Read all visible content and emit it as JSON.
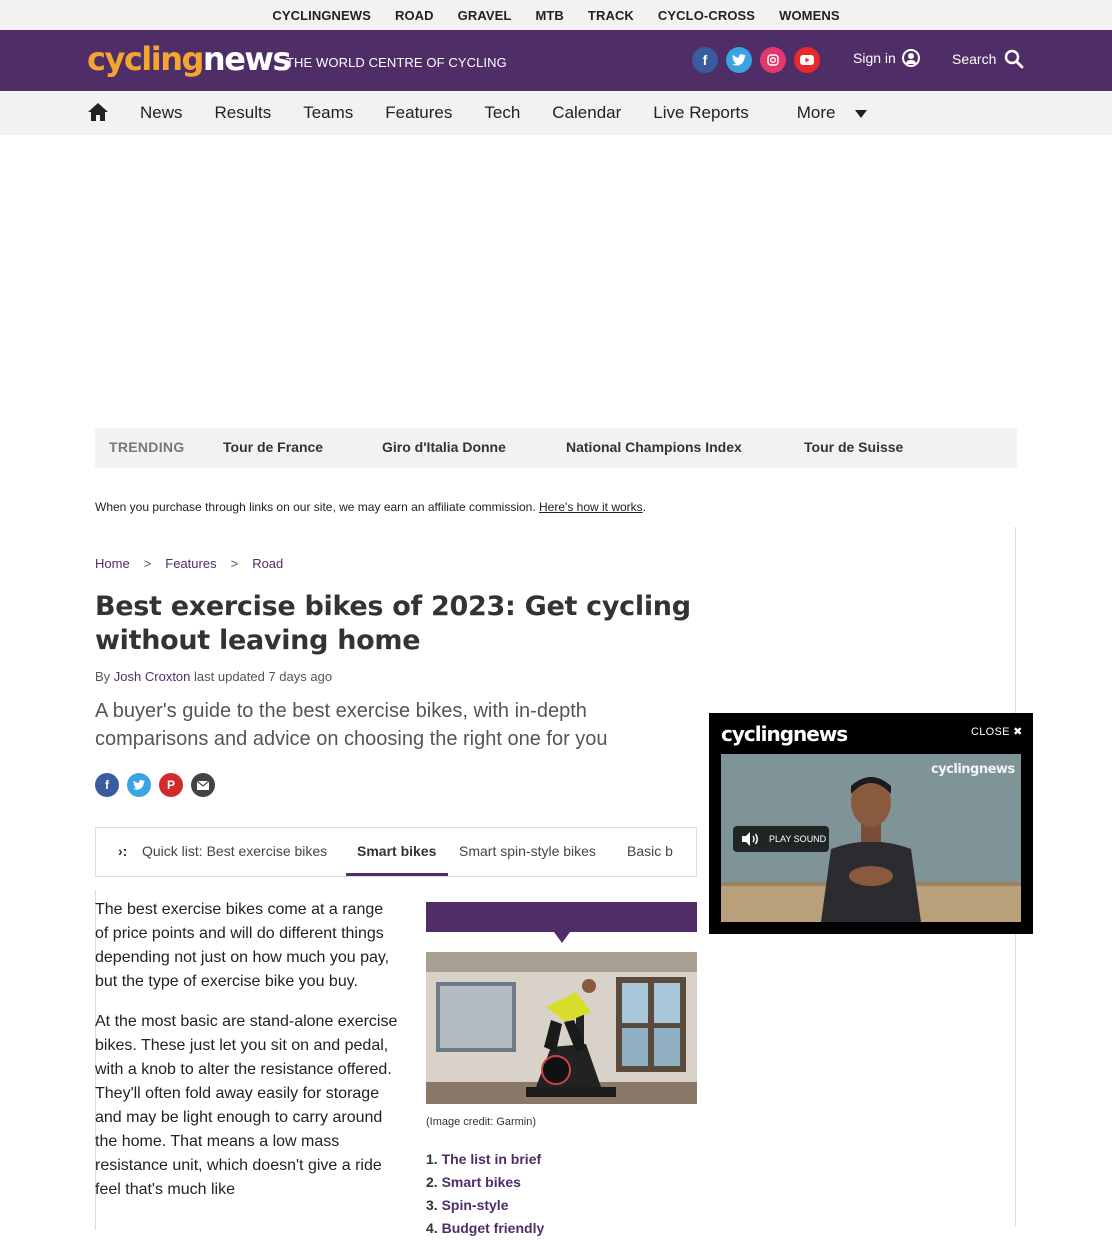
{
  "topbar": {
    "items": [
      "CYCLINGNEWS",
      "ROAD",
      "GRAVEL",
      "MTB",
      "TRACK",
      "CYCLO-CROSS",
      "WOMENS"
    ]
  },
  "header": {
    "logo_part1": "cycling",
    "logo_part2": "news",
    "tagline": "THE WORLD CENTRE OF CYCLING",
    "signin": "Sign in",
    "search": "Search",
    "brand_color": "#4f2e68"
  },
  "nav": {
    "items": [
      "News",
      "Results",
      "Teams",
      "Features",
      "Tech",
      "Calendar",
      "Live Reports"
    ],
    "more": "More"
  },
  "trending": {
    "label": "TRENDING",
    "items": [
      "Tour de France",
      "Giro d'Italia Donne",
      "National Champions Index",
      "Tour de Suisse"
    ]
  },
  "affiliate": {
    "text": "When you purchase through links on our site, we may earn an affiliate commission.",
    "link": "Here's how it works",
    "period": "."
  },
  "breadcrumb": {
    "items": [
      "Home",
      "Features",
      "Road"
    ],
    "sep": ">"
  },
  "article": {
    "title": "Best exercise bikes of 2023: Get cycling without leaving home",
    "by": "By",
    "author": "Josh Croxton",
    "updated": "last updated 7 days ago",
    "strap": "A buyer's guide to the best exercise bikes, with in-depth comparisons and advice on choosing the right one for you",
    "paragraphs": [
      "The best exercise bikes come at a range of price points and will do different things depending not just on how much you pay, but the type of exercise bike you buy.",
      "At the most basic are stand-alone exercise bikes. These just let you sit on and pedal, with a knob to alter the resistance offered. They'll often fold away easily for storage and may be light enough to carry around the home. That means a low mass resistance unit, which doesn't give a ride feel that's much like"
    ],
    "image_credit": "(Image credit: Garmin)"
  },
  "jumplinks": {
    "arrow": "›:",
    "tabs": [
      "Quick list: Best exercise bikes",
      "Smart bikes",
      "Smart spin-style bikes",
      "Basic b"
    ]
  },
  "toc": [
    {
      "num": "1.",
      "label": "The list in brief"
    },
    {
      "num": "2.",
      "label": "Smart bikes"
    },
    {
      "num": "3.",
      "label": "Spin-style"
    },
    {
      "num": "4.",
      "label": "Budget friendly"
    }
  ],
  "video": {
    "logo": "cyclingnews",
    "close": "CLOSE",
    "watermark": "cyclingnews",
    "play_sound": "PLAY SOUND"
  }
}
